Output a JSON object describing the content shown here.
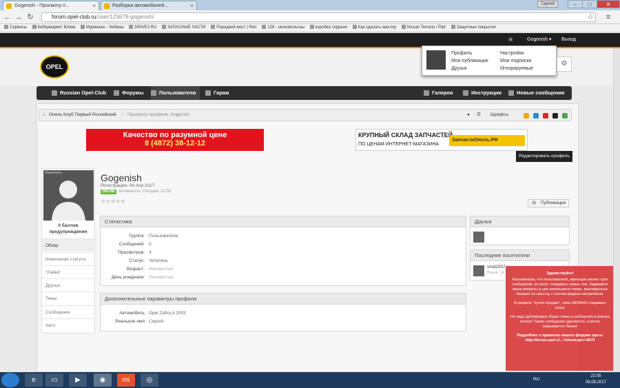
{
  "browser": {
    "tabs": [
      {
        "label": "Gogenish - Просмотр п..."
      },
      {
        "label": "Разборка автомобилей..."
      }
    ],
    "user_chip": "Сергей",
    "url_host": "forum.opel-club.ru",
    "url_path": "/user/123679-gogenish/",
    "bookmarks": [
      "Сервисы",
      "Кибермаркет Юлма",
      "Мурманск - Хибины",
      "DRIVE2.RU",
      "ЗАПАСНЫЕ ЧАСТИ",
      "Передний мост | Ren",
      "128 - низковольтны",
      "коробка террано",
      "Как сделать маслоу",
      "Nissan Terrano / Patr",
      "Защитные покрытия"
    ]
  },
  "site": {
    "top_user": "Gogenish",
    "logout": "Выход",
    "dropdown": {
      "col1": [
        "Профиль",
        "Мои публикации",
        "Друзья"
      ],
      "col2": [
        "Настройки",
        "Мои подписки",
        "Игнорируемые"
      ]
    },
    "nav": {
      "left": [
        "Russian Opel-Club",
        "Форумы",
        "Пользователи",
        "Гараж"
      ],
      "right": [
        "Галерея",
        "Инструкции",
        "Новые сообщения"
      ]
    },
    "breadcrumb": {
      "home": "Опель Клуб Первый Российский",
      "current": "Просмотр профиля: Gogenish"
    },
    "fonts_label": "Шрифты",
    "swatches": [
      "#f2a71c",
      "#2a8bd6",
      "#d42a2a",
      "#222222",
      "#4ca64c"
    ],
    "banner1": {
      "line1": "Качество по разумной цене",
      "line2": "8 (4872) 38-12-12"
    },
    "banner2": {
      "line1": "КРУПНЫЙ СКЛАД ЗАПЧАСТЕЙ",
      "line2": "ПО ЦЕНАМ ИНТЕРНЕТ-МАГАЗИНА",
      "brand": "ЗапчастиОпель.РФ"
    },
    "edit_profile": "Редактировать профиль",
    "profile": {
      "change_label": "Изменить",
      "name": "Gogenish",
      "registered": "Регистрация: 04 Апр 2017",
      "online_badge": "ONLINE",
      "activity": "Активность: Сегодня, 21:59",
      "points": "0 баллов",
      "warnings": "предупреждения",
      "publications_btn": "Публикации",
      "sidebar": [
        "Обзор",
        "Изменения статуса",
        "\"Лайки\"",
        "Друзья",
        "Темы",
        "Сообщения",
        "Авто"
      ]
    },
    "stats": {
      "title": "Статистика",
      "rows": [
        {
          "k": "Группа:",
          "v": "Пользователи"
        },
        {
          "k": "Сообщений:",
          "v": "0"
        },
        {
          "k": "Просмотров:",
          "v": "4"
        },
        {
          "k": "Статус:",
          "v": "Читатель"
        },
        {
          "k": "Возраст:",
          "v": "Неизвестен"
        },
        {
          "k": "День рождения:",
          "v": "Неизвестен"
        }
      ]
    },
    "extra": {
      "title": "Дополнительные параметры профиля",
      "rows": [
        {
          "k": "Автомобиль",
          "v": "Opel Zafira A 2003"
        },
        {
          "k": "Реальное имя",
          "v": "Сергей"
        }
      ]
    },
    "friends_title": "Друзья",
    "visitors": {
      "title": "Последние посетители",
      "name": "smd2007",
      "time": "Вчера, 14:..."
    },
    "notice": {
      "title": "Здравствуйте!",
      "p1": "Напоминаем, что пользователи, имеющие менее трех сообщений, не могут создавать новых тем. Задавайте ваши вопросы в уже имеющихся темах, максимально близких по смыслу, с учетом модели автомобиля.",
      "p2": "В разделе \"купля-продам\", темы МОЖНО создавать сразу.",
      "p3": "Не надо дублировать Ваши темы и сообщения в разных ветках! Такие сообщения удаляются, а автор накрывается банан!",
      "p4": "Подробнее о правилах нашего форума здесь: http://forum.opel-cl...?showtopic=4575"
    }
  },
  "taskbar": {
    "lang": "RU",
    "time": "22:05",
    "date": "08.08.2017"
  }
}
